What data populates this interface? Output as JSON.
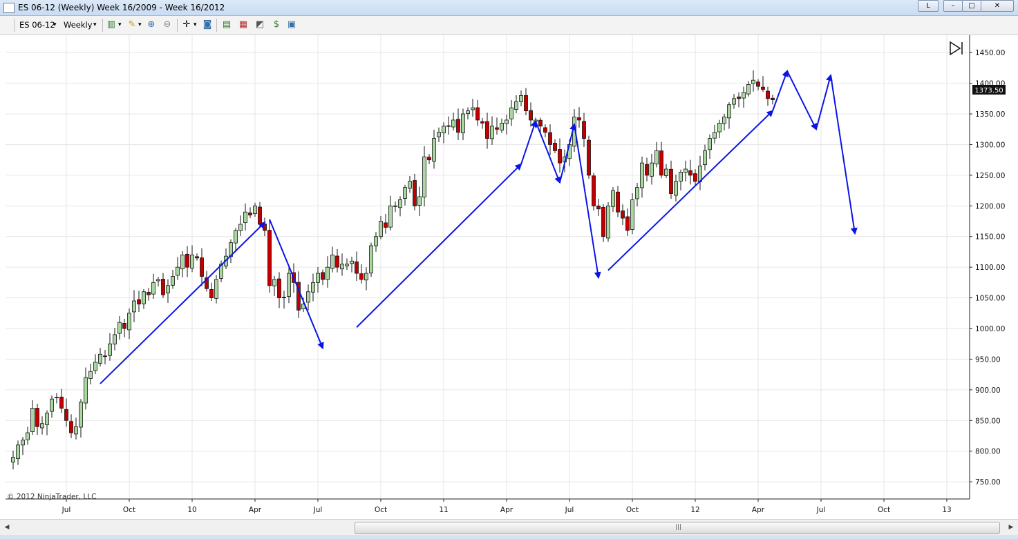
{
  "window": {
    "title": "ES 06-12 (Weekly)  Week 16/2009 - Week 16/2012",
    "btn_l": "L",
    "btn_min": "–",
    "btn_max": "□",
    "btn_close": "✕"
  },
  "toolbar": {
    "instrument": "ES 06-12",
    "period": "Weekly",
    "dropdown": "▾"
  },
  "chart_data": {
    "type": "candlestick",
    "title": "",
    "copyright": "© 2012 NinjaTrader, LLC",
    "price_label": "1373.50",
    "y_ticks": [
      "1450.00",
      "1400.00",
      "1350.00",
      "1300.00",
      "1250.00",
      "1200.00",
      "1150.00",
      "1100.00",
      "1050.00",
      "1000.00",
      "950.00",
      "900.00",
      "850.00",
      "800.00",
      "750.00"
    ],
    "y_tick_values": [
      1450,
      1400,
      1350,
      1300,
      1250,
      1200,
      1150,
      1100,
      1050,
      1000,
      950,
      900,
      850,
      800,
      750
    ],
    "ylim": [
      722,
      1475
    ],
    "x_ticks": [
      {
        "label": "Jul",
        "week": 11
      },
      {
        "label": "Oct",
        "week": 24
      },
      {
        "label": "10",
        "week": 37
      },
      {
        "label": "Apr",
        "week": 50
      },
      {
        "label": "Jul",
        "week": 63
      },
      {
        "label": "Oct",
        "week": 76
      },
      {
        "label": "11",
        "week": 89
      },
      {
        "label": "Apr",
        "week": 102
      },
      {
        "label": "Jul",
        "week": 115
      },
      {
        "label": "Oct",
        "week": 128
      },
      {
        "label": "12",
        "week": 141
      },
      {
        "label": "Apr",
        "week": 154
      },
      {
        "label": "Jul",
        "week": 167
      },
      {
        "label": "Oct",
        "week": 180
      },
      {
        "label": "13",
        "week": 193
      }
    ],
    "grid": true,
    "closes": [
      790,
      810,
      818,
      830,
      870,
      840,
      845,
      862,
      885,
      888,
      870,
      850,
      830,
      840,
      880,
      920,
      930,
      945,
      958,
      955,
      975,
      990,
      1010,
      1000,
      1025,
      1045,
      1040,
      1060,
      1055,
      1075,
      1080,
      1055,
      1070,
      1085,
      1100,
      1120,
      1100,
      1120,
      1115,
      1085,
      1065,
      1050,
      1080,
      1105,
      1118,
      1140,
      1160,
      1170,
      1190,
      1185,
      1200,
      1170,
      1160,
      1070,
      1080,
      1050,
      1050,
      1090,
      1075,
      1030,
      1040,
      1060,
      1075,
      1090,
      1080,
      1100,
      1120,
      1100,
      1105,
      1105,
      1110,
      1090,
      1080,
      1090,
      1135,
      1150,
      1175,
      1165,
      1200,
      1200,
      1210,
      1230,
      1240,
      1200,
      1215,
      1280,
      1275,
      1310,
      1320,
      1330,
      1330,
      1340,
      1320,
      1350,
      1355,
      1360,
      1340,
      1335,
      1310,
      1330,
      1325,
      1335,
      1340,
      1360,
      1370,
      1380,
      1355,
      1340,
      1340,
      1330,
      1320,
      1300,
      1290,
      1270,
      1280,
      1300,
      1345,
      1340,
      1310,
      1250,
      1200,
      1195,
      1150,
      1200,
      1225,
      1190,
      1180,
      1160,
      1210,
      1230,
      1270,
      1250,
      1270,
      1290,
      1250,
      1260,
      1220,
      1240,
      1255,
      1260,
      1250,
      1240,
      1265,
      1290,
      1310,
      1320,
      1335,
      1345,
      1365,
      1375,
      1375,
      1385,
      1398,
      1405,
      1395,
      1390,
      1375,
      1373
    ]
  }
}
